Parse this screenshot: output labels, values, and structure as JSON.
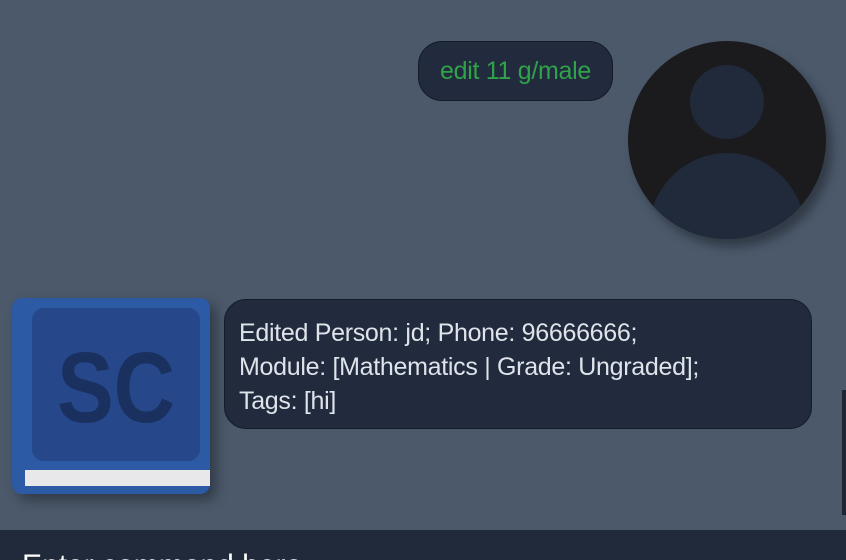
{
  "chat": {
    "user_message": "edit 11 g/male",
    "bot_message_lines": [
      "Edited Person: jd; Phone: 96666666;",
      "Module: [Mathematics | Grade: Ungraded];",
      "Tags: [hi]"
    ],
    "app_logo_text": "SC"
  },
  "command_box": {
    "placeholder": "Enter command here..."
  },
  "colors": {
    "background": "#4b596b",
    "bubble": "#212b3d",
    "user_text": "#2fa24a",
    "bot_text": "#dfe3ea",
    "command_bar": "#202a3b"
  },
  "icons": {
    "user_avatar": "user-avatar-icon",
    "app_logo": "book-logo-icon"
  }
}
